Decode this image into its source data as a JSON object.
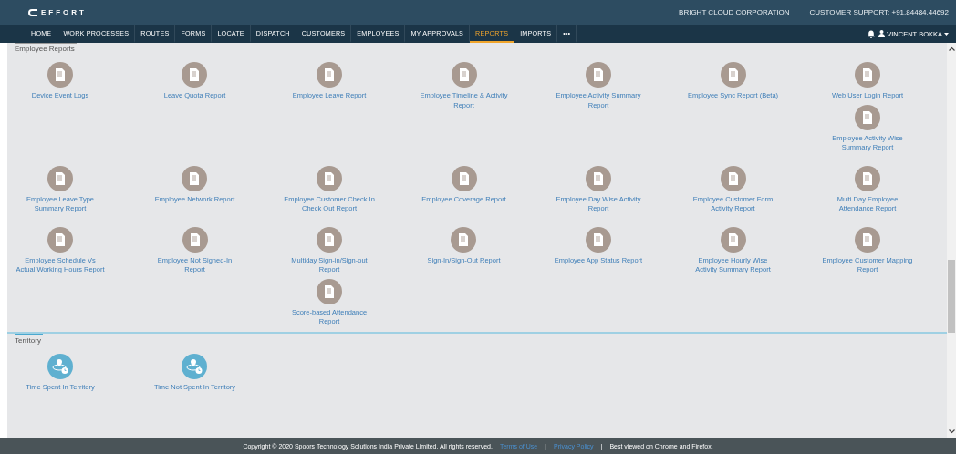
{
  "header": {
    "logo": "EFFORT",
    "company": "BRIGHT CLOUD CORPORATION",
    "support": "CUSTOMER SUPPORT: +91.84484.44692"
  },
  "nav": {
    "items": [
      {
        "label": "HOME",
        "selected": false
      },
      {
        "label": "WORK PROCESSES",
        "selected": false
      },
      {
        "label": "ROUTES",
        "selected": false
      },
      {
        "label": "FORMS",
        "selected": false
      },
      {
        "label": "LOCATE",
        "selected": false
      },
      {
        "label": "DISPATCH",
        "selected": false
      },
      {
        "label": "CUSTOMERS",
        "selected": false
      },
      {
        "label": "EMPLOYEES",
        "selected": false
      },
      {
        "label": "MY APPROVALS",
        "selected": false
      },
      {
        "label": "REPORTS",
        "selected": true
      },
      {
        "label": "IMPORTS",
        "selected": false
      },
      {
        "label": "•••",
        "selected": false
      }
    ],
    "user": "VINCENT BOKKA"
  },
  "sections": [
    {
      "title": "Employee Reports",
      "color": "#a89a91",
      "kind": "report",
      "rows": [
        [
          [
            "Device Event Logs"
          ],
          [
            "Leave Quota Report"
          ],
          [
            "Employee Leave Report"
          ],
          [
            "Employee Timeline & Activity Report"
          ],
          [
            "Employee Activity Summary Report"
          ],
          [
            "Employee Sync Report (Beta)"
          ],
          [
            "Web User Login Report",
            "Employee Activity Wise Summary Report"
          ]
        ],
        [
          [
            "Employee Leave Type Summary Report"
          ],
          [
            "Employee Network Report"
          ],
          [
            "Employee Customer Check In Check Out Report"
          ],
          [
            "Employee Coverage Report"
          ],
          [
            "Employee Day Wise Activity Report"
          ],
          [
            "Employee Customer Form Activity Report"
          ],
          [
            "Multi Day Employee Attendance Report"
          ]
        ],
        [
          [
            "Employee Schedule Vs Actual Working Hours Report"
          ],
          [
            "Employee Not Signed-In Report"
          ],
          [
            "Multiday Sign-in/Sign-out Report",
            "Score-based Attendance Report"
          ],
          [
            "Sign-In/Sign-Out Report"
          ],
          [
            "Employee App Status Report"
          ],
          [
            "Employee Hourly Wise Activity Summary Report"
          ],
          [
            "Employee Customer Mapping Report"
          ]
        ]
      ]
    },
    {
      "title": "Territory",
      "color": "#5fb0d0",
      "kind": "territory",
      "rows": [
        [
          [
            "Time Spent In Territory"
          ],
          [
            "Time Not Spent In Territory"
          ]
        ]
      ]
    }
  ],
  "footer": {
    "copyright": "Copyright © 2020 Spoors Technology Solutions India Private Limited. All rights reserved.",
    "links": [
      {
        "label": "Terms of Use",
        "separator": "|"
      },
      {
        "label": "Privacy Policy",
        "separator": "|"
      }
    ],
    "note": "Best viewed on Chrome and Firefox."
  }
}
